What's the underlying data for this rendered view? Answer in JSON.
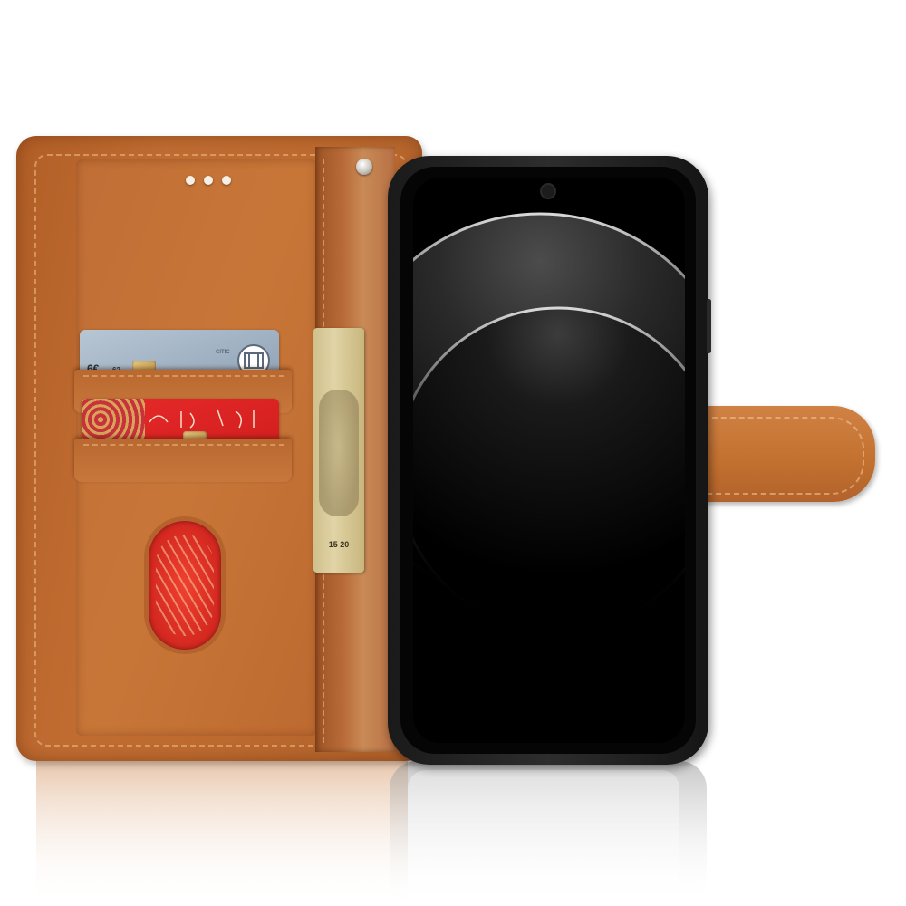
{
  "product": {
    "type": "leather wallet phone case",
    "case_color": "#c06c31",
    "phone_color": "#0a0a0a"
  },
  "cards": {
    "blue_card": {
      "partial_text": "6€",
      "sub_text": "62",
      "logo_text": "CITIC"
    },
    "red_card": {
      "color": "#d82424"
    }
  },
  "banknote": {
    "serial": "15 20"
  }
}
